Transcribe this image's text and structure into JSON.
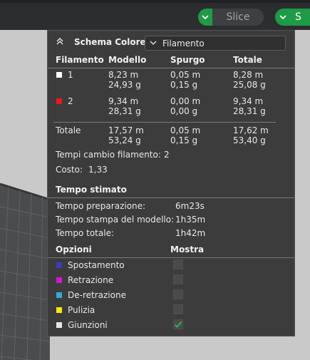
{
  "toolbar": {
    "slice_label": "Slice",
    "send_label": "S",
    "accent": "#1f9a47"
  },
  "panel": {
    "title": "Schema Colore",
    "mode_select": "Filamento",
    "columns": [
      "Filamento",
      "Modello",
      "Spurgo",
      "Totale"
    ],
    "filaments": [
      {
        "id": "1",
        "color": "#ffffff",
        "modello_m": "8,23 m",
        "modello_g": "24,93 g",
        "spurgo_m": "0,05 m",
        "spurgo_g": "0,15 g",
        "totale_m": "8,28 m",
        "totale_g": "25,08 g"
      },
      {
        "id": "2",
        "color": "#e8181c",
        "modello_m": "9,34 m",
        "modello_g": "28,31 g",
        "spurgo_m": "0,00 m",
        "spurgo_g": "0,00 g",
        "totale_m": "9,34 m",
        "totale_g": "28,31 g"
      }
    ],
    "total": {
      "label": "Totale",
      "modello_m": "17,57 m",
      "modello_g": "53,24 g",
      "spurgo_m": "0,05 m",
      "spurgo_g": "0,15 g",
      "totale_m": "17,62 m",
      "totale_g": "53,40 g"
    },
    "filament_changes_label": "Tempi cambio filamento:",
    "filament_changes_value": "2",
    "cost_label": "Costo:",
    "cost_value": "1,33",
    "time_section": "Tempo stimato",
    "times": [
      {
        "label": "Tempo preparazione:",
        "value": "6m23s"
      },
      {
        "label": "Tempo stampa del modello:",
        "value": "1h35m"
      },
      {
        "label": "Tempo totale:",
        "value": "1h42m"
      }
    ],
    "options_header": "Opzioni",
    "show_header": "Mostra",
    "options": [
      {
        "label": "Spostamento",
        "color": "#3a3dbf",
        "checked": false
      },
      {
        "label": "Retrazione",
        "color": "#d315d3",
        "checked": false
      },
      {
        "label": "De-retrazione",
        "color": "#3aa6d8",
        "checked": false
      },
      {
        "label": "Pulizia",
        "color": "#f5e80f",
        "checked": false
      },
      {
        "label": "Giunzioni",
        "color": "#e6e6e6",
        "checked": true
      }
    ]
  }
}
